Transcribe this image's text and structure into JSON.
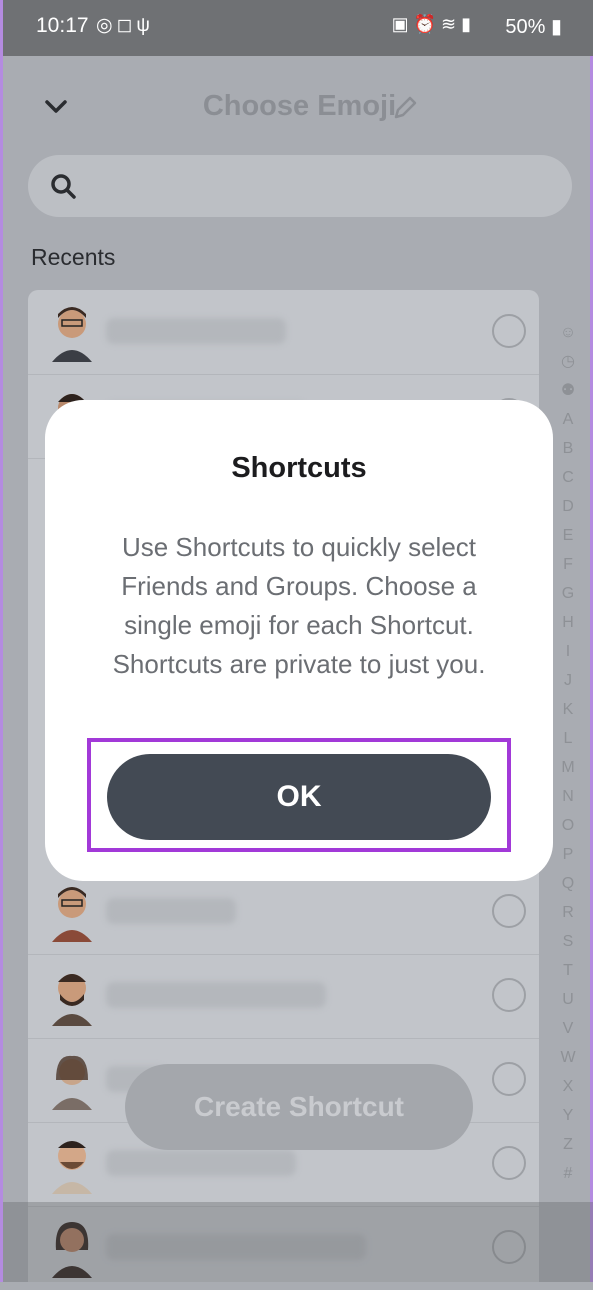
{
  "status_bar": {
    "time": "10:17",
    "battery": "50%",
    "left_icons": [
      "whatsapp-icon",
      "instagram-icon",
      "usb-icon"
    ],
    "right_icons": [
      "lock-icon",
      "alarm-icon",
      "wifi-icon",
      "volte-icon",
      "signal-icon",
      "battery-icon"
    ]
  },
  "header": {
    "title": "Choose Emoji",
    "back_icon": "chevron-down-icon",
    "edit_icon": "pencil-icon"
  },
  "search": {
    "placeholder": ""
  },
  "section": {
    "recents_label": "Recents"
  },
  "alphabet_index": [
    "A",
    "B",
    "C",
    "D",
    "E",
    "F",
    "G",
    "H",
    "I",
    "J",
    "K",
    "L",
    "M",
    "N",
    "O",
    "P",
    "Q",
    "R",
    "S",
    "T",
    "U",
    "V",
    "W",
    "X",
    "Y",
    "Z",
    "#"
  ],
  "index_icons": [
    "smiley-icon",
    "clock-icon",
    "group-icon"
  ],
  "create_button": {
    "label": "Create Shortcut"
  },
  "dialog": {
    "title": "Shortcuts",
    "body": "Use Shortcuts to quickly select Friends and Groups. Choose a single emoji for each Shortcut. Shortcuts are private to just you.",
    "ok_label": "OK",
    "highlight_color": "#a239d8"
  },
  "colors": {
    "accent_purple": "#a239d8",
    "button_dark": "#434a54"
  }
}
